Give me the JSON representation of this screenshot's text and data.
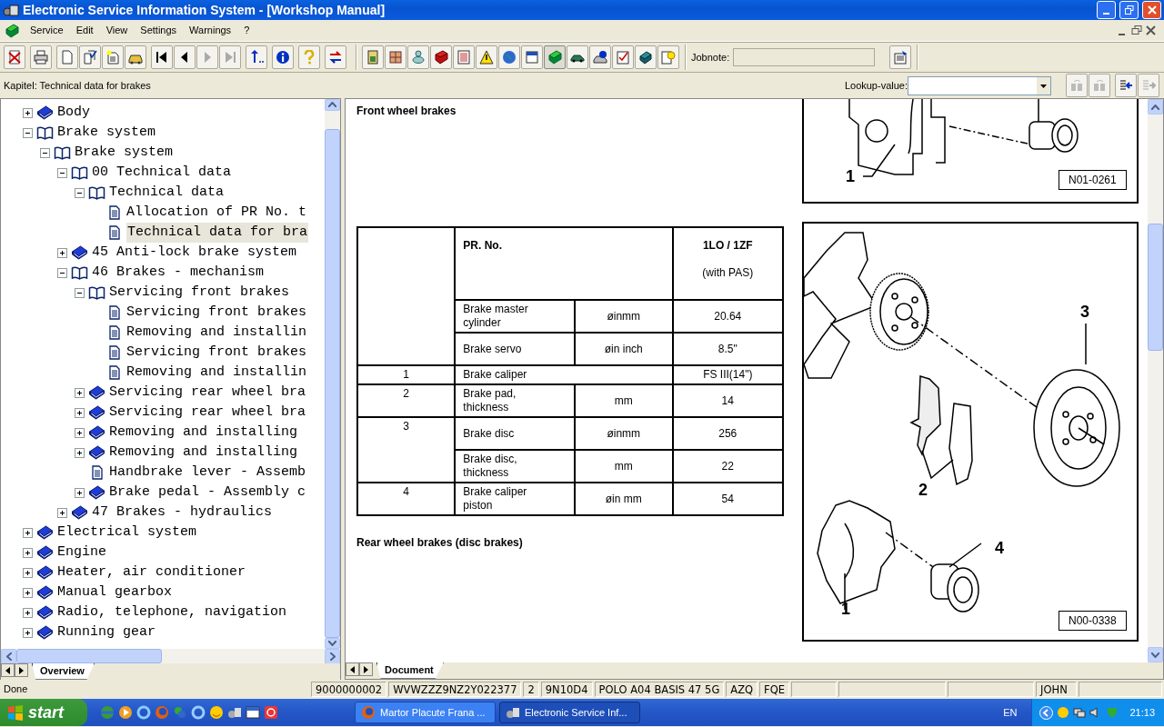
{
  "window": {
    "title": "Electronic Service Information System - [Workshop Manual]"
  },
  "menu": [
    "Service",
    "Edit",
    "View",
    "Settings",
    "Warnings",
    "?"
  ],
  "toolbar": {
    "jobnote_label": "Jobnote:"
  },
  "chapter_bar": {
    "chapter": "Kapitel: Technical data for brakes",
    "lookup_label": "Lookup-value:"
  },
  "tree": [
    {
      "label": "Body",
      "kind": "book",
      "expanded": false,
      "selected": false
    },
    {
      "label": "Brake system",
      "kind": "book",
      "expanded": true,
      "selected": false,
      "children": [
        {
          "label": "Brake system",
          "kind": "book",
          "expanded": true,
          "selected": false,
          "children": [
            {
              "label": "00 Technical data",
              "kind": "book",
              "expanded": true,
              "selected": false,
              "children": [
                {
                  "label": "Technical data",
                  "kind": "book",
                  "expanded": true,
                  "selected": false,
                  "children": [
                    {
                      "label": "Allocation of PR No. t",
                      "kind": "page",
                      "selected": false
                    },
                    {
                      "label": "Technical data for bra",
                      "kind": "page",
                      "selected": true
                    }
                  ]
                }
              ]
            },
            {
              "label": "45 Anti-lock brake system",
              "kind": "book",
              "expanded": false,
              "selected": false
            },
            {
              "label": "46 Brakes - mechanism",
              "kind": "book",
              "expanded": true,
              "selected": false,
              "children": [
                {
                  "label": "Servicing front brakes",
                  "kind": "book",
                  "expanded": true,
                  "selected": false,
                  "children": [
                    {
                      "label": "Servicing front brakes",
                      "kind": "page",
                      "selected": false
                    },
                    {
                      "label": "Removing and installin",
                      "kind": "page",
                      "selected": false
                    },
                    {
                      "label": "Servicing front brakes",
                      "kind": "page",
                      "selected": false
                    },
                    {
                      "label": "Removing and installin",
                      "kind": "page",
                      "selected": false
                    }
                  ]
                },
                {
                  "label": "Servicing rear wheel bra",
                  "kind": "book",
                  "expanded": false,
                  "selected": false
                },
                {
                  "label": "Servicing rear wheel bra",
                  "kind": "book",
                  "expanded": false,
                  "selected": false
                },
                {
                  "label": "Removing and installing",
                  "kind": "book",
                  "expanded": false,
                  "selected": false
                },
                {
                  "label": "Removing and installing",
                  "kind": "book",
                  "expanded": false,
                  "selected": false
                },
                {
                  "label": "Handbrake lever - Assemb",
                  "kind": "page",
                  "selected": false
                },
                {
                  "label": "Brake pedal - Assembly c",
                  "kind": "book",
                  "expanded": false,
                  "selected": false
                }
              ]
            },
            {
              "label": "47 Brakes - hydraulics",
              "kind": "book",
              "expanded": false,
              "selected": false
            }
          ]
        }
      ]
    },
    {
      "label": "Electrical system",
      "kind": "book",
      "expanded": false,
      "selected": false
    },
    {
      "label": "Engine",
      "kind": "book",
      "expanded": false,
      "selected": false
    },
    {
      "label": "Heater, air conditioner",
      "kind": "book",
      "expanded": false,
      "selected": false
    },
    {
      "label": "Manual gearbox",
      "kind": "book",
      "expanded": false,
      "selected": false
    },
    {
      "label": "Radio, telephone, navigation",
      "kind": "book",
      "expanded": false,
      "selected": false
    },
    {
      "label": "Running gear",
      "kind": "book",
      "expanded": false,
      "selected": false
    }
  ],
  "tree_tabs": [
    {
      "label": "Overview",
      "selected": true
    }
  ],
  "document": {
    "front_heading": "Front wheel brakes",
    "table": {
      "pr_label": "PR. No.",
      "value_label": "1LO / 1ZF",
      "value_note": "(with PAS)",
      "rows": [
        {
          "item": "Brake master cylinder",
          "unit": "øinmm",
          "value": "20.64"
        },
        {
          "item": "Brake servo",
          "unit": "øin inch",
          "value": "8.5\""
        },
        {
          "num": "1",
          "item": "Brake caliper",
          "value": "FS III(14\")"
        },
        {
          "num": "2",
          "item": "Brake pad, thickness",
          "unit": "mm",
          "value": "14"
        },
        {
          "num": "3",
          "item": "Brake disc",
          "unit": "øinmm",
          "value": "256"
        },
        {
          "item": "Brake disc, thickness",
          "unit": "mm",
          "value": "22"
        },
        {
          "num": "4",
          "item": "Brake caliper piston",
          "unit": "øin mm",
          "value": "54"
        }
      ]
    },
    "rear_heading": "Rear wheel brakes (disc brakes)",
    "figures": [
      {
        "code": "N01-0261",
        "callouts": [
          "1"
        ]
      },
      {
        "code": "N00-0338",
        "callouts": [
          "3",
          "2",
          "4",
          "1"
        ]
      }
    ]
  },
  "doc_tabs": [
    {
      "label": "Document",
      "selected": true
    }
  ],
  "status_bar": {
    "message": "Done",
    "fields": [
      "9000000002",
      "WVWZZZ9NZ2Y022377",
      "2",
      "9N10D4",
      "POLO A04 BASIS 47 5G",
      "AZQ",
      "FQE"
    ],
    "user": "JOHN"
  },
  "taskbar": {
    "start": "start",
    "tasks": [
      {
        "label": "Martor Placute Frana ...",
        "selected": false
      },
      {
        "label": "Electronic Service Inf...",
        "selected": true
      }
    ],
    "language": "EN",
    "clock": "21:13"
  }
}
